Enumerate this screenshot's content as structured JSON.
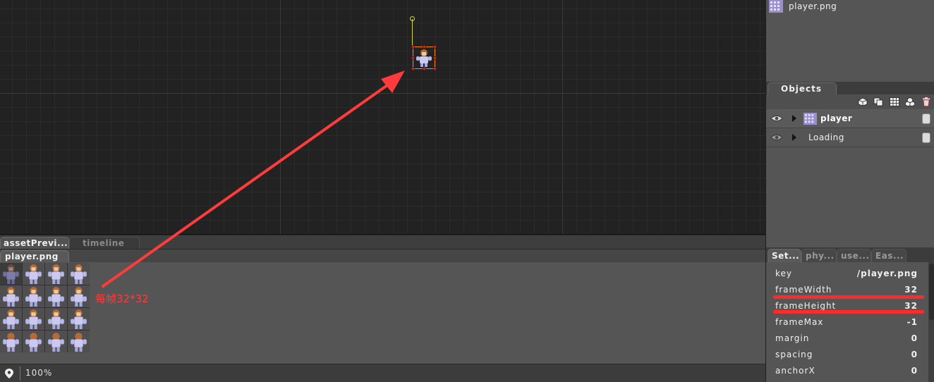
{
  "canvas": {
    "zoom_label": "100%"
  },
  "bottom_panel": {
    "tabs": [
      {
        "label": "assetPrevi..."
      },
      {
        "label": "timeline"
      }
    ],
    "file_tab": "player.png",
    "annotation": "每帧32*32"
  },
  "right_panel": {
    "asset_item": {
      "label": "player.png",
      "icon": "spritesheet-icon"
    },
    "objects_tab": "Objects",
    "toolbar_icons": [
      "cube-icon",
      "duplicate-icon",
      "grid-icon",
      "group-icon",
      "trash-icon"
    ],
    "objects": [
      {
        "label": "player",
        "icon": "spritesheet-icon",
        "visible": true,
        "locked": true
      },
      {
        "label": "Loading",
        "icon": "",
        "visible": true,
        "locked": true
      }
    ],
    "props_tabs": [
      "Set...",
      "phy...",
      "use...",
      "Eas..."
    ],
    "properties": [
      {
        "key": "key",
        "value": "/player.png"
      },
      {
        "key": "frameWidth",
        "value": "32"
      },
      {
        "key": "frameHeight",
        "value": "32"
      },
      {
        "key": "frameMax",
        "value": "-1"
      },
      {
        "key": "margin",
        "value": "0"
      },
      {
        "key": "spacing",
        "value": "0"
      },
      {
        "key": "anchorX",
        "value": "0"
      }
    ]
  },
  "colors": {
    "selection": "#ff8a00",
    "rotation_handle": "#d8d040",
    "annotation": "#ff3b3b"
  }
}
